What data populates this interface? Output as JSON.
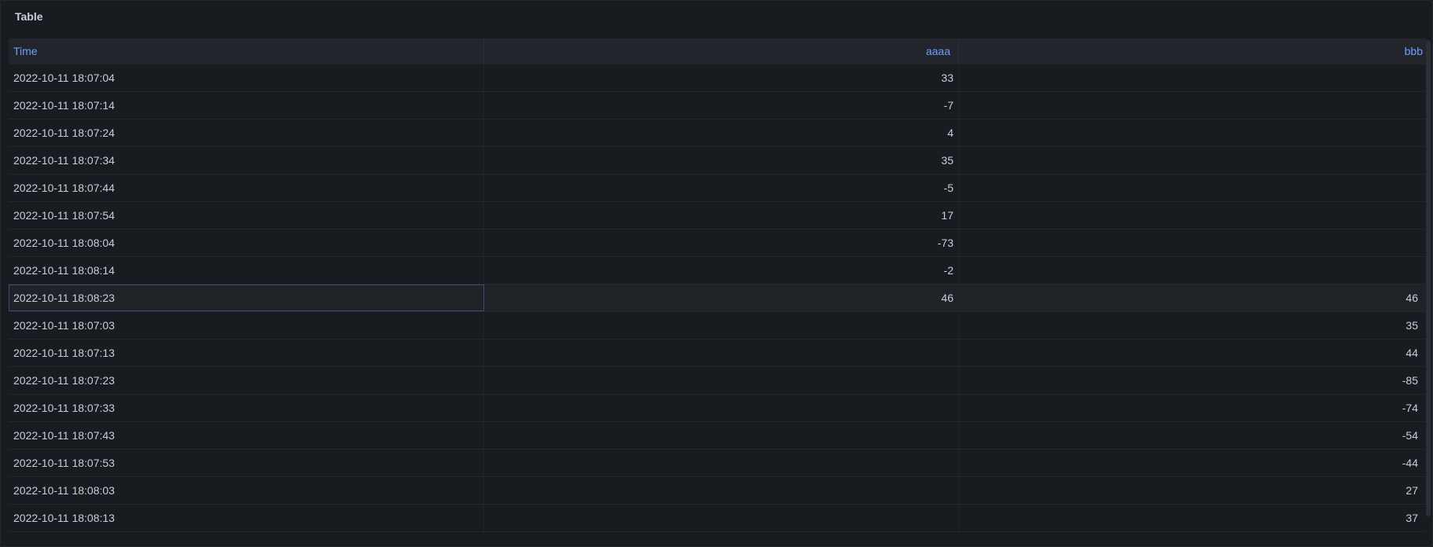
{
  "panel": {
    "title": "Table"
  },
  "table": {
    "columns": [
      "Time",
      "aaaa",
      "bbb"
    ],
    "rows": [
      {
        "time": "2022-10-11 18:07:04",
        "aaaa": "33",
        "bbb": ""
      },
      {
        "time": "2022-10-11 18:07:14",
        "aaaa": "-7",
        "bbb": ""
      },
      {
        "time": "2022-10-11 18:07:24",
        "aaaa": "4",
        "bbb": ""
      },
      {
        "time": "2022-10-11 18:07:34",
        "aaaa": "35",
        "bbb": ""
      },
      {
        "time": "2022-10-11 18:07:44",
        "aaaa": "-5",
        "bbb": ""
      },
      {
        "time": "2022-10-11 18:07:54",
        "aaaa": "17",
        "bbb": ""
      },
      {
        "time": "2022-10-11 18:08:04",
        "aaaa": "-73",
        "bbb": ""
      },
      {
        "time": "2022-10-11 18:08:14",
        "aaaa": "-2",
        "bbb": ""
      },
      {
        "time": "2022-10-11 18:08:23",
        "aaaa": "46",
        "bbb": "46"
      },
      {
        "time": "2022-10-11 18:07:03",
        "aaaa": "",
        "bbb": "35"
      },
      {
        "time": "2022-10-11 18:07:13",
        "aaaa": "",
        "bbb": "44"
      },
      {
        "time": "2022-10-11 18:07:23",
        "aaaa": "",
        "bbb": "-85"
      },
      {
        "time": "2022-10-11 18:07:33",
        "aaaa": "",
        "bbb": "-74"
      },
      {
        "time": "2022-10-11 18:07:43",
        "aaaa": "",
        "bbb": "-54"
      },
      {
        "time": "2022-10-11 18:07:53",
        "aaaa": "",
        "bbb": "-44"
      },
      {
        "time": "2022-10-11 18:08:03",
        "aaaa": "",
        "bbb": "27"
      },
      {
        "time": "2022-10-11 18:08:13",
        "aaaa": "",
        "bbb": "37"
      }
    ],
    "highlighted_row": 8
  },
  "colors": {
    "background": "#181b1f",
    "header_text": "#6e9fff",
    "cell_text": "#ccccdc"
  }
}
